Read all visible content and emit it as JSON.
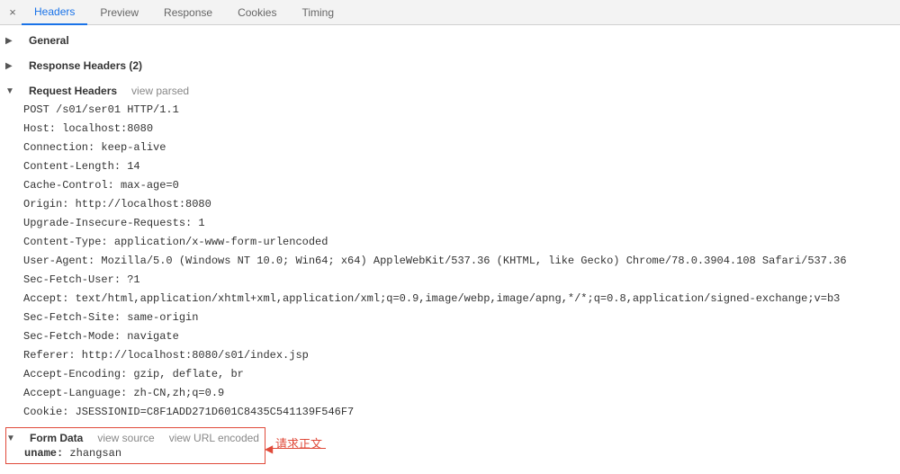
{
  "tabs": {
    "headers": "Headers",
    "preview": "Preview",
    "response": "Response",
    "cookies": "Cookies",
    "timing": "Timing"
  },
  "sections": {
    "general": "General",
    "response_headers": "Response Headers (2)",
    "request_headers": "Request Headers",
    "form_data": "Form Data"
  },
  "aux": {
    "view_parsed": "view parsed",
    "view_source": "view source",
    "view_url_encoded": "view URL encoded"
  },
  "request_raw": "POST /s01/ser01 HTTP/1.1\nHost: localhost:8080\nConnection: keep-alive\nContent-Length: 14\nCache-Control: max-age=0\nOrigin: http://localhost:8080\nUpgrade-Insecure-Requests: 1\nContent-Type: application/x-www-form-urlencoded\nUser-Agent: Mozilla/5.0 (Windows NT 10.0; Win64; x64) AppleWebKit/537.36 (KHTML, like Gecko) Chrome/78.0.3904.108 Safari/537.36\nSec-Fetch-User: ?1\nAccept: text/html,application/xhtml+xml,application/xml;q=0.9,image/webp,image/apng,*/*;q=0.8,application/signed-exchange;v=b3\nSec-Fetch-Site: same-origin\nSec-Fetch-Mode: navigate\nReferer: http://localhost:8080/s01/index.jsp\nAccept-Encoding: gzip, deflate, br\nAccept-Language: zh-CN,zh;q=0.9\nCookie: JSESSIONID=C8F1ADD271D601C8435C541139F546F7",
  "form": {
    "uname_key": "uname:",
    "uname_val": " zhangsan"
  },
  "annotation": "请求正文",
  "glyphs": {
    "close": "×",
    "right": "▶",
    "down": "▼"
  }
}
